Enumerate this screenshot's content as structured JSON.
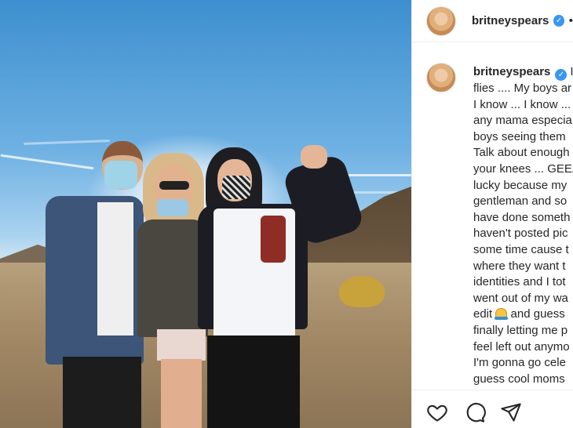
{
  "post": {
    "username": "britneyspears",
    "verified": true,
    "separator": "•"
  },
  "caption": {
    "username": "britneyspears",
    "first_line_tail": "I",
    "lines": [
      "flies .... My boys ar",
      "I know ... I know ...",
      "any mama especia",
      "boys seeing them",
      "Talk about enough",
      "your knees ... GEEZ",
      "lucky because my",
      "gentleman and so",
      "have done someth",
      "haven't posted pic",
      "some time cause t",
      "where they want t",
      "identities and I tot",
      "went out of my wa",
      "edit",
      "finally letting me p",
      "feel left out anymo",
      "I'm gonna go cele",
      "guess cool moms"
    ],
    "emoji_line_tail": "and guess"
  },
  "actions": {
    "like_icon": "heart-icon",
    "comment_icon": "comment-bubble-icon",
    "share_icon": "paper-plane-icon"
  },
  "colors": {
    "verified_blue": "#3897f0",
    "text": "#262626",
    "divider": "#efefef"
  }
}
